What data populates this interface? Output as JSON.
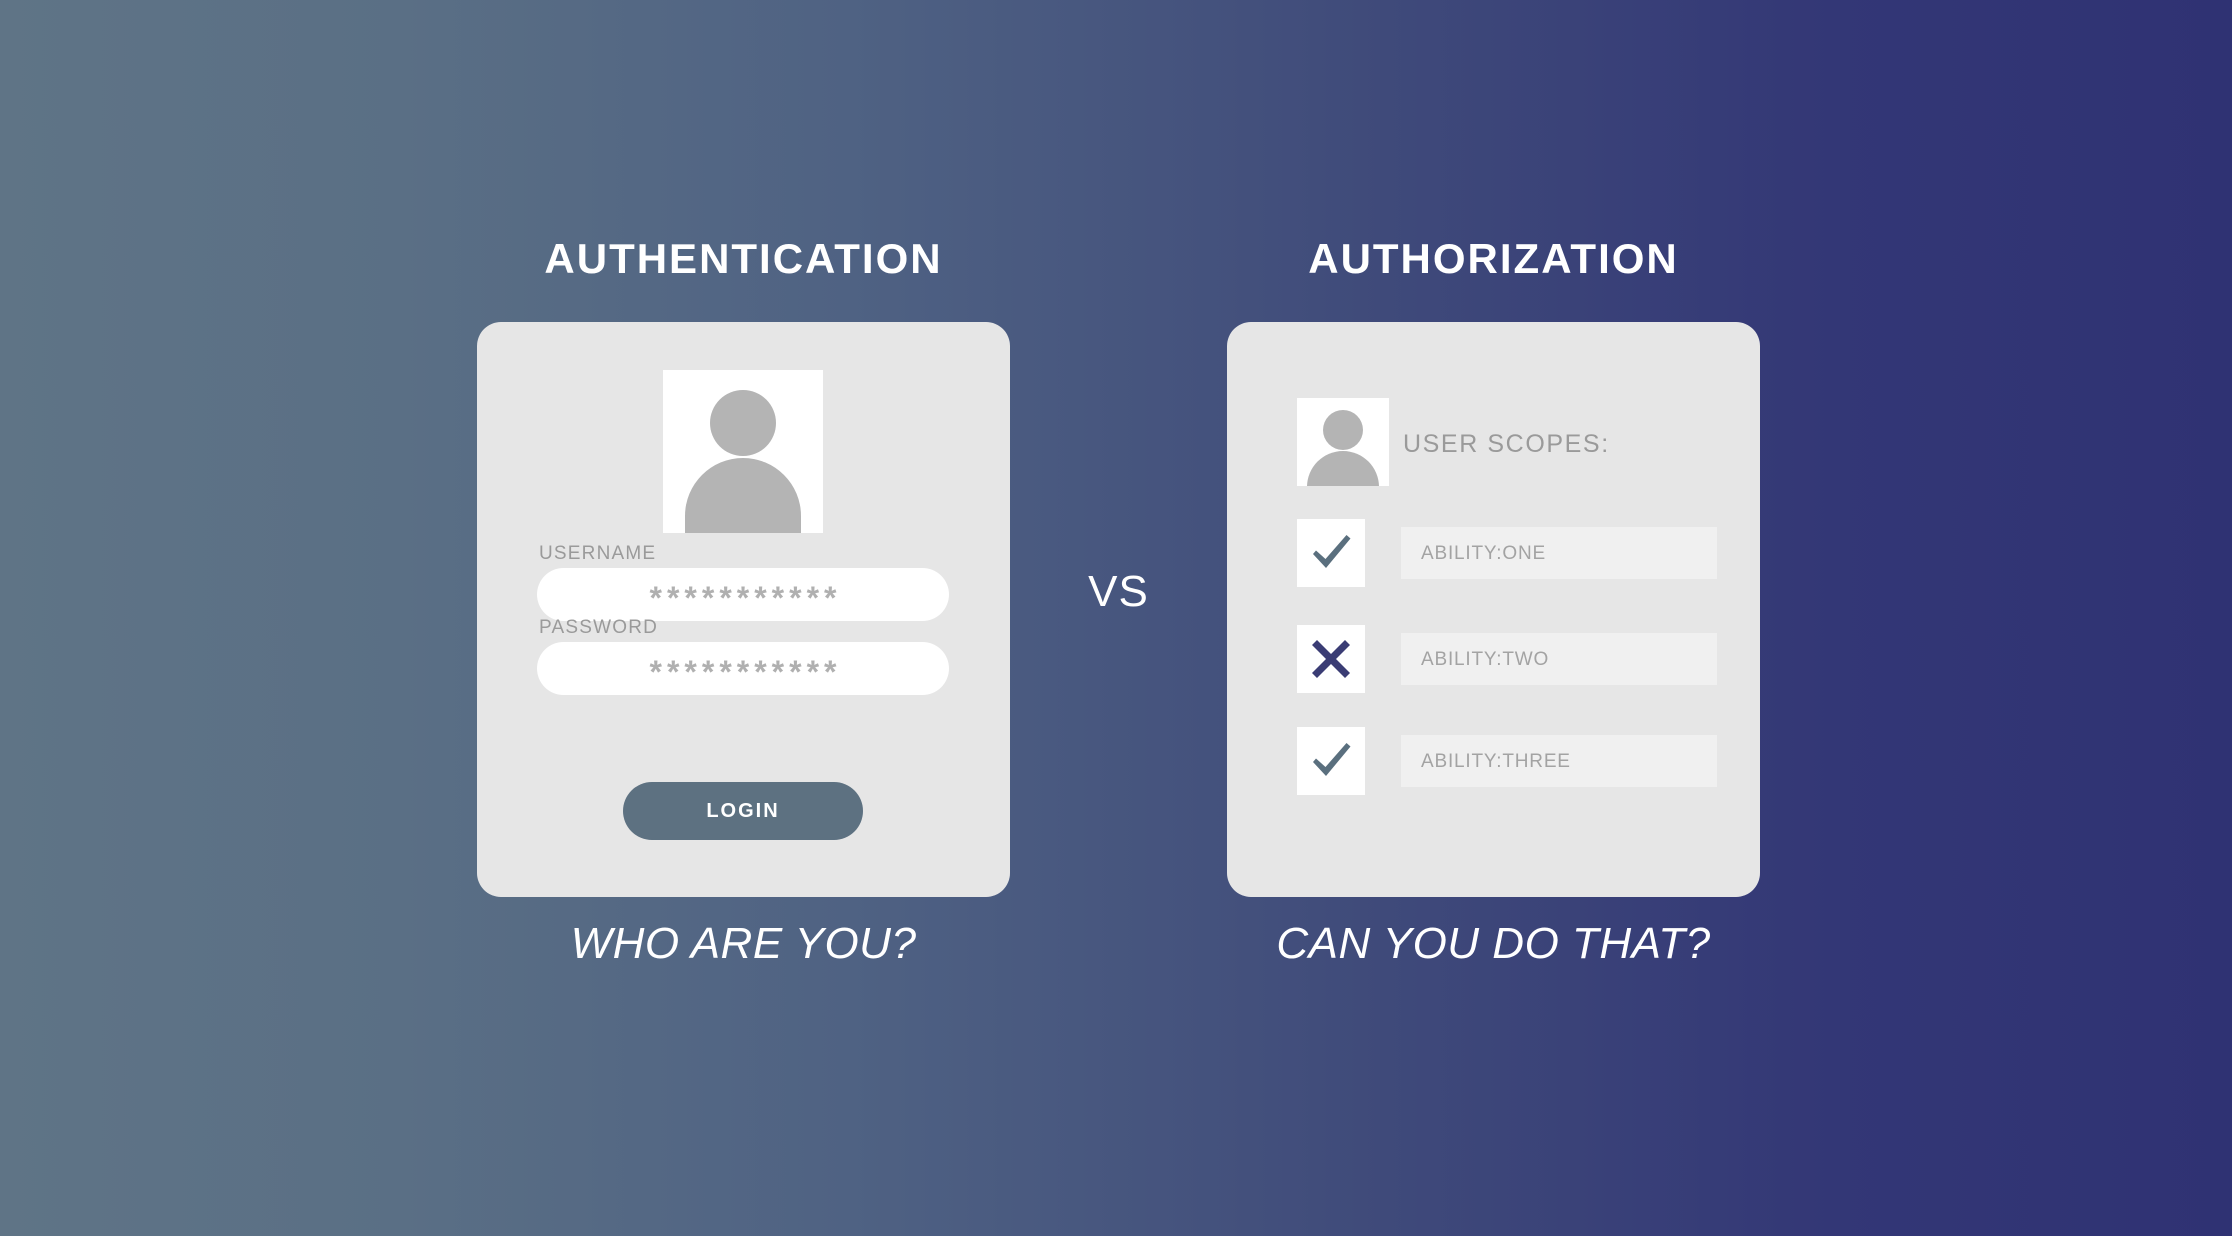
{
  "theme": {
    "bg_gradient_left": "#5f7486",
    "bg_gradient_right": "#2f3273",
    "card_bg": "#e6e6e6",
    "accent_slate": "#5d7181",
    "accent_indigo": "#3a3c74",
    "muted_text": "#9a9a9a"
  },
  "divider": {
    "label": "VS"
  },
  "authentication": {
    "heading": "AUTHENTICATION",
    "caption": "WHO ARE YOU?",
    "avatar_icon": "user-avatar-icon",
    "fields": [
      {
        "label": "USERNAME",
        "value": "***********",
        "name": "username"
      },
      {
        "label": "PASSWORD",
        "value": "***********",
        "name": "password"
      }
    ],
    "submit_label": "LOGIN"
  },
  "authorization": {
    "heading": "AUTHORIZATION",
    "caption": "CAN YOU DO THAT?",
    "avatar_icon": "user-avatar-icon",
    "scopes_title": "USER SCOPES:",
    "scopes": [
      {
        "value": "ABILITY:ONE",
        "granted": true,
        "mark": "check-icon",
        "mark_color": "#5a6f7e"
      },
      {
        "value": "ABILITY:TWO",
        "granted": false,
        "mark": "cross-icon",
        "mark_color": "#3a3c74"
      },
      {
        "value": "ABILITY:THREE",
        "granted": true,
        "mark": "check-icon",
        "mark_color": "#5a6f7e"
      }
    ]
  }
}
